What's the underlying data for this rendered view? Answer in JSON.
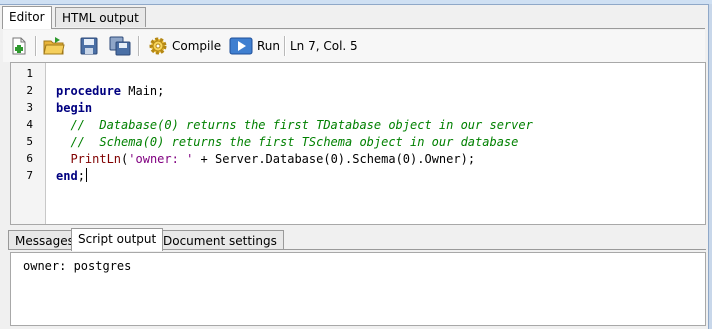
{
  "top_tabs": [
    {
      "label": "Editor",
      "active": true
    },
    {
      "label": "HTML output",
      "active": false
    }
  ],
  "toolbar": {
    "new_icon": "new-document-icon",
    "open_icon": "open-folder-icon",
    "save_icon": "save-icon",
    "save_all_icon": "save-all-icon",
    "compile_label": "Compile",
    "compile_icon": "gear-icon",
    "run_label": "Run",
    "run_icon": "play-icon",
    "position": "Ln 7, Col. 5"
  },
  "editor": {
    "line_numbers": [
      "1",
      "2",
      "3",
      "4",
      "5",
      "6",
      "7"
    ]
  },
  "bottom_tabs": [
    {
      "label": "Messages",
      "active": false
    },
    {
      "label": "Script output",
      "active": true
    },
    {
      "label": "Document settings",
      "active": false
    }
  ],
  "output": {
    "text": "owner: postgres"
  }
}
